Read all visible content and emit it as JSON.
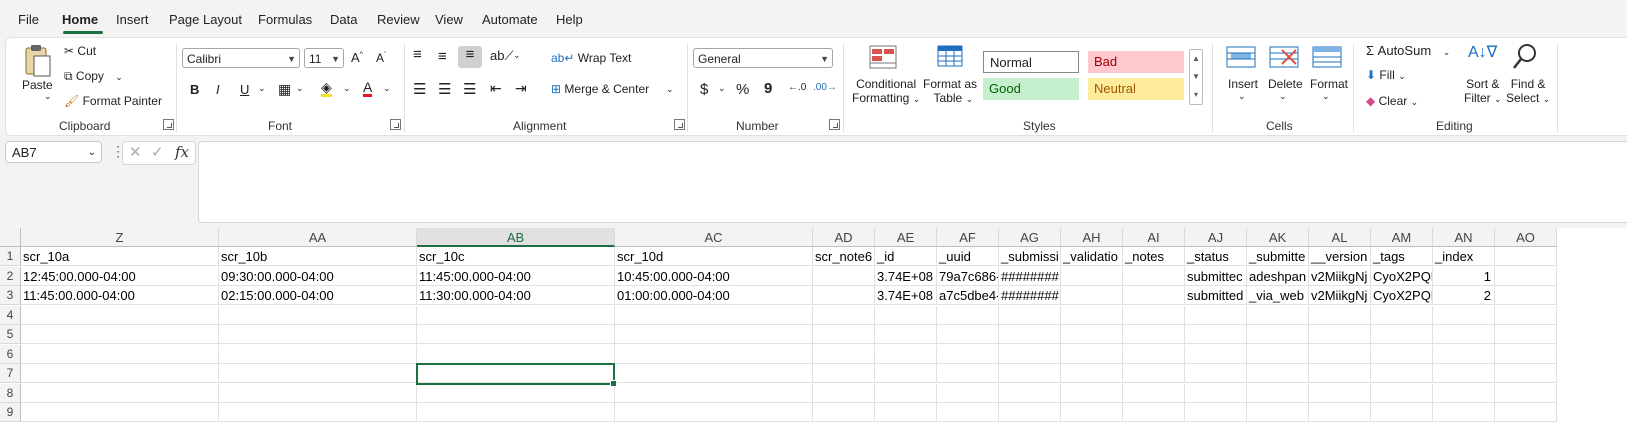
{
  "menu": [
    "File",
    "Home",
    "Insert",
    "Page Layout",
    "Formulas",
    "Data",
    "Review",
    "View",
    "Automate",
    "Help"
  ],
  "ribbon": {
    "clipboard": {
      "paste": "Paste",
      "cut": "Cut",
      "copy": "Copy",
      "format_painter": "Format Painter",
      "label": "Clipboard"
    },
    "font": {
      "name": "Calibri",
      "size": "11",
      "bold": "B",
      "italic": "I",
      "underline": "U",
      "label": "Font"
    },
    "alignment": {
      "wrap_text": "Wrap Text",
      "merge_center": "Merge & Center",
      "label": "Alignment"
    },
    "number": {
      "format": "General",
      "currency": "$",
      "percent": "%",
      "comma": "9",
      "label": "Number"
    },
    "styles": {
      "conditional": "Conditional",
      "conditional2": "Formatting",
      "format_as": "Format as",
      "format_as2": "Table",
      "normal": "Normal",
      "bad": "Bad",
      "good": "Good",
      "neutral": "Neutral",
      "label": "Styles"
    },
    "cells": {
      "insert": "Insert",
      "delete": "Delete",
      "format": "Format",
      "label": "Cells"
    },
    "editing": {
      "autosum": "AutoSum",
      "fill": "Fill",
      "clear": "Clear",
      "sort": "Sort &",
      "sort2": "Filter",
      "find": "Find &",
      "find2": "Select",
      "label": "Editing"
    }
  },
  "formula_bar": {
    "name_box": "AB7",
    "fx": "fx",
    "content": ""
  },
  "columns": [
    "Z",
    "AA",
    "AB",
    "AC",
    "AD",
    "AE",
    "AF",
    "AG",
    "AH",
    "AI",
    "AJ",
    "AK",
    "AL",
    "AM",
    "AN",
    "AO"
  ],
  "selected_column": "AB",
  "rows": [
    "1",
    "2",
    "3",
    "4",
    "5",
    "6",
    "7",
    "8",
    "9"
  ],
  "cells": [
    [
      "scr_10a",
      "scr_10b",
      "scr_10c",
      "scr_10d",
      "scr_note6",
      "_id",
      "_uuid",
      "_submissi",
      "_validatio",
      "_notes",
      "_status",
      "_submitte",
      "__version",
      "_tags",
      "_index",
      ""
    ],
    [
      "12:45:00.000-04:00",
      "09:30:00.000-04:00",
      "11:45:00.000-04:00",
      "10:45:00.000-04:00",
      "",
      "3.74E+08",
      "79a7c686-",
      "########",
      "",
      "",
      "submittec",
      "adeshpan",
      "v2MiikgNj",
      "CyoX2PQK",
      "1",
      ""
    ],
    [
      "11:45:00.000-04:00",
      "02:15:00.000-04:00",
      "11:30:00.000-04:00",
      "01:00:00.000-04:00",
      "",
      "3.74E+08",
      "a7c5dbe4-",
      "########",
      "",
      "",
      "submitted",
      "_via_web",
      "v2MiikgNj",
      "CyoX2PQK",
      "2",
      ""
    ]
  ],
  "active_cell": "AB7"
}
